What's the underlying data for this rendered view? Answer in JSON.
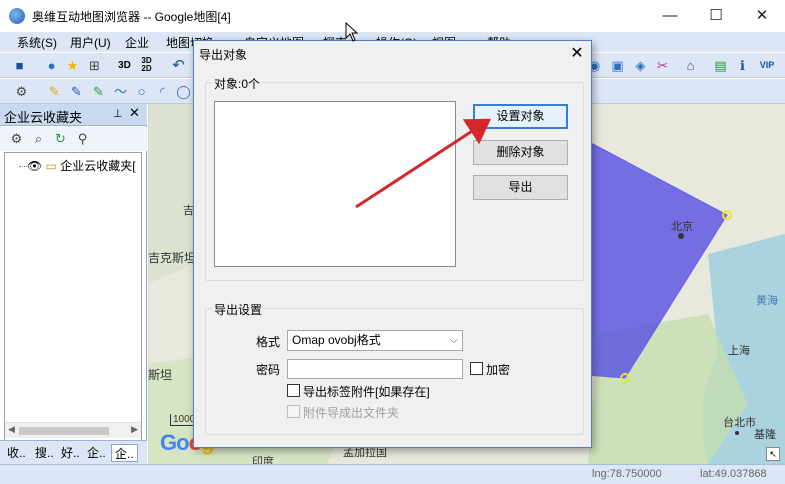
{
  "window": {
    "title": "奥维互动地图浏览器 -- Google地图[4]",
    "minimize": "—",
    "maximize": "☐",
    "close": "✕"
  },
  "menu": {
    "items": [
      "系统(S)",
      "用户(U)",
      "企业",
      "地图切换",
      "自定义地图",
      "探索",
      "操作(O)",
      "视图",
      "帮助"
    ]
  },
  "left_panel": {
    "title": "企业云收藏夹",
    "pin": "ᵖ",
    "close": "✕",
    "tree_root": "企业云收藏夹[",
    "tabs": [
      "收..",
      "搜..",
      "好..",
      "企..",
      "企.."
    ]
  },
  "map": {
    "labels": {
      "beijing": "北京",
      "shanghai": "上海",
      "huanghai": "黄海",
      "taibei": "台北市",
      "jiliang": "基隆",
      "kirgiz": "吉克斯坦",
      "tan": "斯坦",
      "ji": "吉",
      "yindu": "印度",
      "mengjiala": "孟加拉国",
      "scale": "1000"
    },
    "polygon_color": "#4a3fe6"
  },
  "status": {
    "lng": "lng:78.750000",
    "lat": "lat:49.037868"
  },
  "dialog": {
    "title": "导出对象",
    "close": "✕",
    "objects_group": "对象:0个",
    "buttons": {
      "set_object": "设置对象",
      "delete_object": "删除对象",
      "export": "导出"
    },
    "settings_group": "导出设置",
    "format_label": "格式",
    "format_value": "Omap ovobj格式",
    "password_label": "密码",
    "encrypt_label": "加密",
    "export_tag_attachments": "导出标签附件[如果存在]",
    "attachments_to_folder": "附件导成出文件夹"
  },
  "colors": {
    "accent": "#3a7bd5",
    "arrow": "#d2282d",
    "menubar": "#dce6f4"
  }
}
